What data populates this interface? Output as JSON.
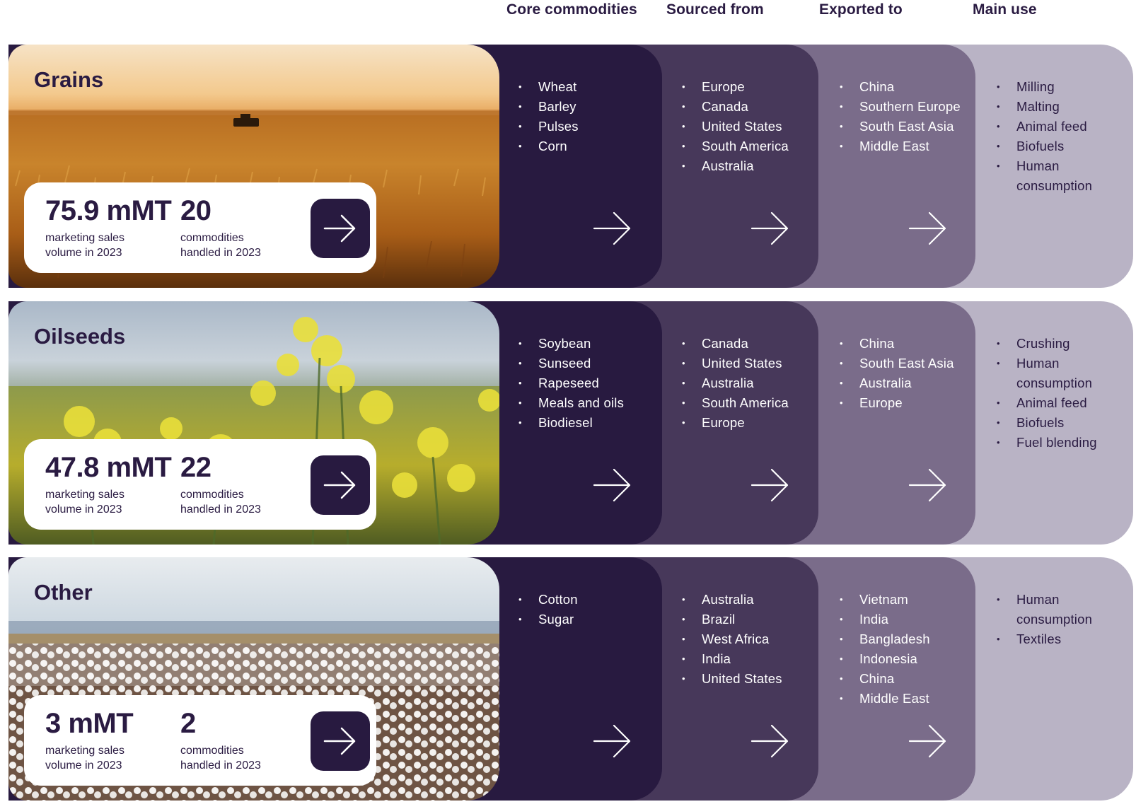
{
  "headers": [
    "Core commodities",
    "Sourced from",
    "Exported to",
    "Main use"
  ],
  "rows": [
    {
      "title": "Grains",
      "stat1_value": "75.9 mMT",
      "stat1_label": "marketing sales\nvolume in 2023",
      "stat2_value": "20",
      "stat2_label": "commodities\nhandled in 2023",
      "image": "wheat-field-with-harvester",
      "commodities": [
        "Wheat",
        "Barley",
        "Pulses",
        "Corn"
      ],
      "sourced_from": [
        "Europe",
        "Canada",
        "United States",
        "South America",
        "Australia"
      ],
      "exported_to": [
        "China",
        "Southern Europe",
        "South East Asia",
        "Middle East"
      ],
      "main_use": [
        "Milling",
        "Malting",
        "Animal feed",
        "Biofuels",
        "Human consumption"
      ]
    },
    {
      "title": "Oilseeds",
      "stat1_value": "47.8 mMT",
      "stat1_label": "marketing sales\nvolume in 2023",
      "stat2_value": "22",
      "stat2_label": "commodities\nhandled in 2023",
      "image": "canola-flower-field",
      "commodities": [
        "Soybean",
        "Sunseed",
        "Rapeseed",
        "Meals and oils",
        "Biodiesel"
      ],
      "sourced_from": [
        "Canada",
        "United States",
        "Australia",
        "South America",
        "Europe"
      ],
      "exported_to": [
        "China",
        "South East Asia",
        "Australia",
        "Europe"
      ],
      "main_use": [
        "Crushing",
        "Human consumption",
        "Animal feed",
        "Biofuels",
        "Fuel blending"
      ]
    },
    {
      "title": "Other",
      "stat1_value": "3 mMT",
      "stat1_label": "marketing sales\nvolume in 2023",
      "stat2_value": "2",
      "stat2_label": "commodities\nhandled in 2023",
      "image": "cotton-field",
      "commodities": [
        "Cotton",
        "Sugar"
      ],
      "sourced_from": [
        "Australia",
        "Brazil",
        "West Africa",
        "India",
        "United States"
      ],
      "exported_to": [
        "Vietnam",
        "India",
        "Bangladesh",
        "Indonesia",
        "China",
        "Middle East"
      ],
      "main_use": [
        "Human consumption",
        "Textiles"
      ]
    }
  ],
  "colors": {
    "dark_purple": "#281a40",
    "mid_purple": "#47385a",
    "muted_purple": "#7a6c8a",
    "light_purple": "#b9b3c5",
    "card_white": "#ffffff"
  },
  "icons": {
    "card_button": "arrow-right-icon",
    "column_arrow": "arrow-right-icon"
  }
}
